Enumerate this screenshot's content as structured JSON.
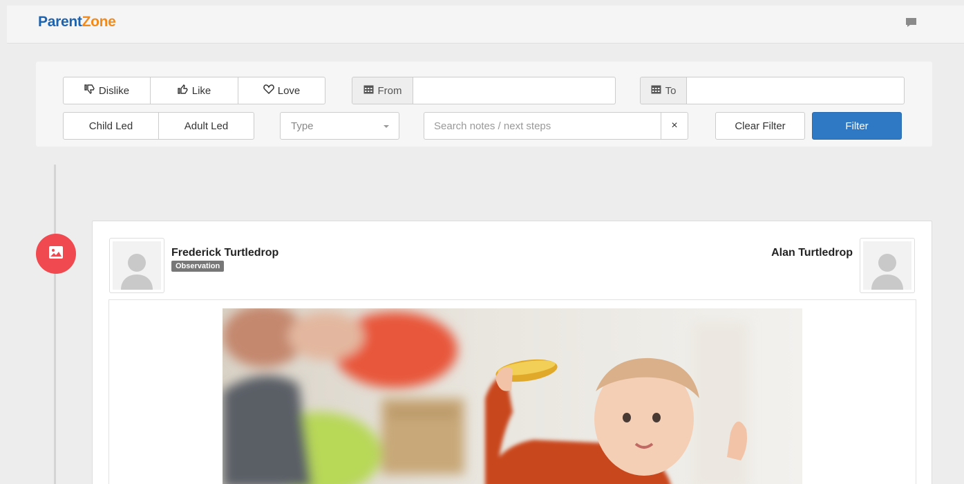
{
  "brand": {
    "part1": "Parent",
    "part2": "Zone"
  },
  "header": {
    "messages_icon": "chat-bubble-icon"
  },
  "filters": {
    "reactions": [
      {
        "label": "Dislike",
        "icon": "thumbs-down-icon"
      },
      {
        "label": "Like",
        "icon": "thumbs-up-icon"
      },
      {
        "label": "Love",
        "icon": "heart-icon"
      }
    ],
    "from_label": "From",
    "to_label": "To",
    "from_value": "",
    "to_value": "",
    "led": [
      "Child Led",
      "Adult Led"
    ],
    "type_placeholder": "Type",
    "search_placeholder": "Search notes / next steps",
    "search_clear": "×",
    "clear_filter": "Clear Filter",
    "filter": "Filter"
  },
  "timeline": {
    "entry_icon": "image-icon",
    "entry_color": "#f04a50",
    "card": {
      "child_name": "Frederick Turtledrop",
      "badge": "Observation",
      "staff_name": "Alan Turtledrop"
    }
  },
  "colors": {
    "brand_blue": "#1d63b0",
    "brand_orange": "#f28b1c",
    "primary": "#2f78c3"
  }
}
